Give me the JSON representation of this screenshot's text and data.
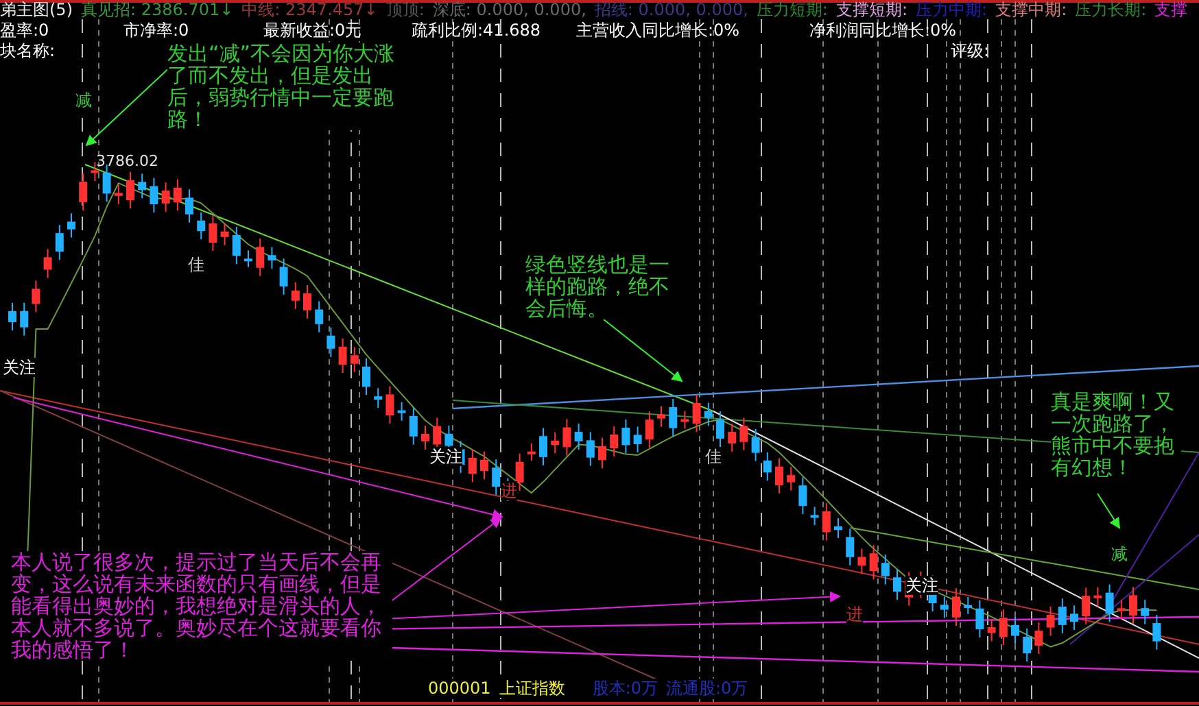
{
  "legend": [
    {
      "text": "弟主图(5)",
      "color": "#e8e8e8"
    },
    {
      "text": "真见招: 2386.701↓",
      "color": "#3a9a3a"
    },
    {
      "text": "中线: 2347.457↓",
      "color": "#9a3a3a"
    },
    {
      "text": "顶顶:",
      "color": "#555555"
    },
    {
      "text": "深底: 0.000, 0.000,",
      "color": "#6a6a6a"
    },
    {
      "text": "招线: 0.000, 0.000,",
      "color": "#3a3a8a"
    },
    {
      "text": "压力短期:",
      "color": "#2e8b2e"
    },
    {
      "text": "支撑短期:",
      "color": "#e0a0e0"
    },
    {
      "text": "压力中期:",
      "color": "#2020c0"
    },
    {
      "text": "支撑中期:",
      "color": "#e08080"
    },
    {
      "text": "压力长期:",
      "color": "#2e8b2e"
    },
    {
      "text": "支撑",
      "color": "#e020e0"
    }
  ],
  "info": [
    "盈率:0",
    "市净率:0",
    "最新收益:0元",
    "疏利比例:41.688",
    "主营收入同比增长:0%",
    "净利润同比增长:0%"
  ],
  "info2": [
    "块名称:",
    "评级:"
  ],
  "price_label": "3786.02",
  "signals": [
    {
      "text": "减",
      "kind": "sell"
    },
    {
      "text": "佳",
      "kind": "good"
    },
    {
      "text": "关注",
      "kind": "watch"
    },
    {
      "text": "关注",
      "kind": "watch"
    },
    {
      "text": "佳",
      "kind": "good"
    },
    {
      "text": "进",
      "kind": "buy"
    },
    {
      "text": "进",
      "kind": "buy"
    },
    {
      "text": "关注",
      "kind": "watch"
    },
    {
      "text": "减",
      "kind": "sell"
    }
  ],
  "notes": [
    {
      "text": "发出“减”不会因为你大涨了而不发出，但是发出后，弱势行情中一定要跑路！",
      "color": "#33cc33"
    },
    {
      "text": "绿色竖线也是一样的跑路，绝不会后悔。",
      "color": "#33cc33"
    },
    {
      "text": "真是爽啊！又一次跑路了，熊市中不要抱有幻想！",
      "color": "#33cc33"
    },
    {
      "text": "本人说了很多次，提示过了当天后不会再变，这么说有未来函数的只有画线，但是能看得出奥妙的，我想绝对是滑头的人，本人就不多说了。奥妙尽在个这就要看你我的感悟了！",
      "color": "#e020e0"
    }
  ],
  "footer": {
    "code": "000001",
    "name": "上证指数",
    "share_capital": "股本:0万",
    "float_shares": "流通股:0万"
  }
}
